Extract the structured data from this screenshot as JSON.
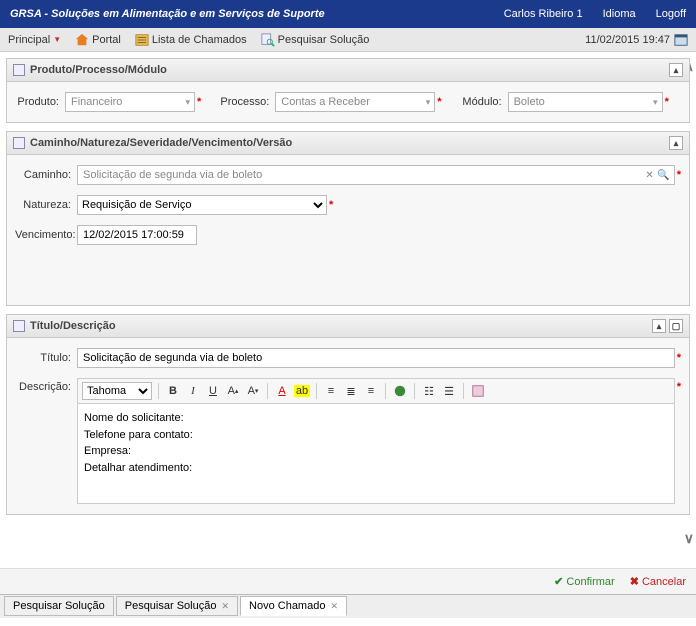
{
  "header": {
    "appTitle": "GRSA - Soluções em Alimentação e em Serviços de Suporte",
    "user": "Carlos Ribeiro 1",
    "language": "Idioma",
    "logoff": "Logoff"
  },
  "toolbar": {
    "principal": "Principal",
    "portal": "Portal",
    "listaChamados": "Lista de Chamados",
    "pesquisarSolucao": "Pesquisar Solução",
    "datetime": "11/02/2015 19:47"
  },
  "sections": {
    "produto": {
      "title": "Produto/Processo/Módulo",
      "labels": {
        "produto": "Produto:",
        "processo": "Processo:",
        "modulo": "Módulo:"
      },
      "values": {
        "produto": "Financeiro",
        "processo": "Contas a Receber",
        "modulo": "Boleto"
      }
    },
    "caminho": {
      "title": "Caminho/Natureza/Severidade/Vencimento/Versão",
      "labels": {
        "caminho": "Caminho:",
        "natureza": "Natureza:",
        "vencimento": "Vencimento:"
      },
      "values": {
        "caminho": "Solicitação de segunda via de boleto",
        "natureza": "Requisição de Serviço",
        "vencimento": "12/02/2015 17:00:59"
      }
    },
    "titulo": {
      "title": "Título/Descrição",
      "labels": {
        "titulo": "Título:",
        "descricao": "Descrição:"
      },
      "values": {
        "titulo": "Solicitação de segunda via de boleto",
        "font": "Tahoma"
      },
      "bodyLines": {
        "l1": "Nome do solicitante:",
        "l2": "Telefone para contato:",
        "l3": "Empresa:",
        "l4": "Detalhar atendimento:"
      }
    }
  },
  "actions": {
    "confirm": "Confirmar",
    "cancel": "Cancelar"
  },
  "tabs": {
    "t1": "Pesquisar Solução",
    "t2": "Pesquisar Solução",
    "t3": "Novo Chamado"
  }
}
